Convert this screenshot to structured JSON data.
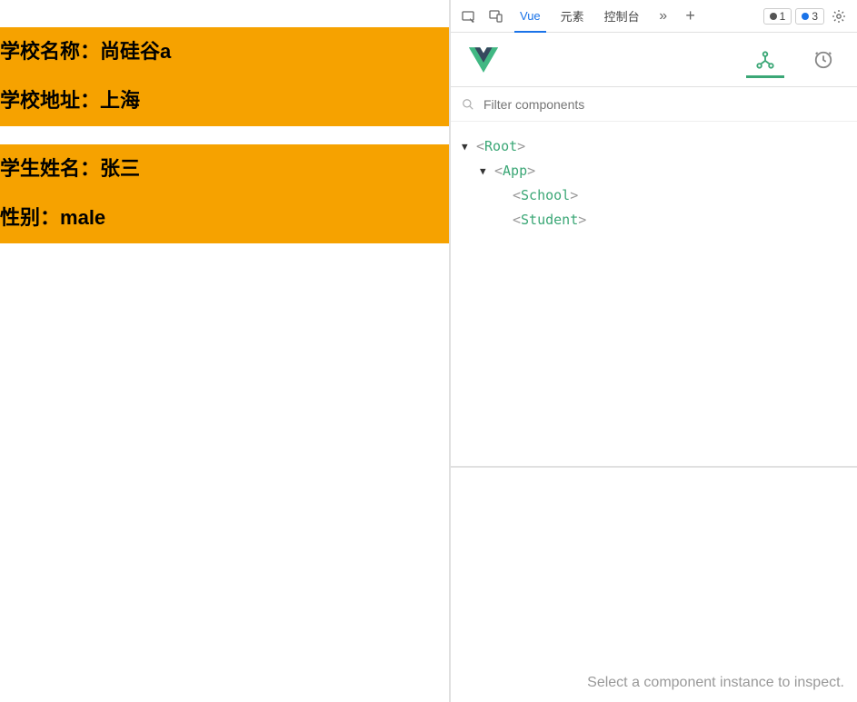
{
  "page": {
    "school": {
      "nameLabel": "学校名称：",
      "name": "尚硅谷a",
      "addrLabel": "学校地址：",
      "addr": "上海"
    },
    "student": {
      "nameLabel": "学生姓名：",
      "name": "张三",
      "sexLabel": "性别：",
      "sex": "male"
    }
  },
  "devtools": {
    "tabs": [
      "Vue",
      "元素",
      "控制台"
    ],
    "activeTab": "Vue",
    "badges": {
      "warn": "1",
      "info": "3"
    },
    "filterPlaceholder": "Filter components",
    "tree": {
      "root": "Root",
      "app": "App",
      "school": "School",
      "student": "Student"
    },
    "inspectMsg": "Select a component instance to inspect."
  }
}
